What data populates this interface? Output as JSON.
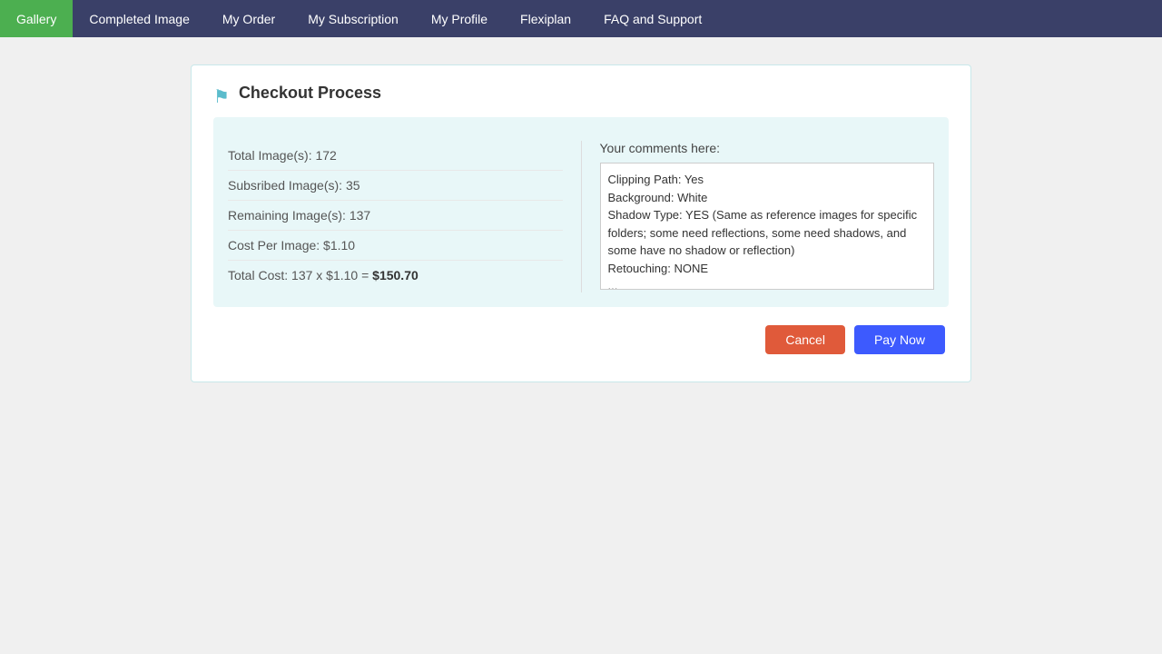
{
  "navbar": {
    "items": [
      {
        "id": "gallery",
        "label": "Gallery",
        "active": true
      },
      {
        "id": "completed-image",
        "label": "Completed Image",
        "active": false
      },
      {
        "id": "my-order",
        "label": "My Order",
        "active": false
      },
      {
        "id": "my-subscription",
        "label": "My Subscription",
        "active": false
      },
      {
        "id": "my-profile",
        "label": "My Profile",
        "active": false
      },
      {
        "id": "flexiplan",
        "label": "Flexiplan",
        "active": false
      },
      {
        "id": "faq-support",
        "label": "FAQ and Support",
        "active": false
      }
    ]
  },
  "checkout": {
    "title": "Checkout Process",
    "total_images_label": "Total Image(s): 172",
    "subscribed_images_label": "Subsribed Image(s): 35",
    "remaining_images_label": "Remaining Image(s): 137",
    "cost_per_image_label": "Cost Per Image: $1.10",
    "total_cost_label": "Total Cost: 137 x $1.10 = ",
    "total_cost_bold": "$150.70",
    "comments_label": "Your comments here:",
    "comments_value": "Clipping Path: Yes\nBackground: White\nShadow Type: YES (Same as reference images for specific folders; some need reflections, some need shadows, and some have no shadow or reflection)\nRetouching: NONE\n..."
  },
  "buttons": {
    "cancel_label": "Cancel",
    "pay_label": "Pay Now"
  }
}
